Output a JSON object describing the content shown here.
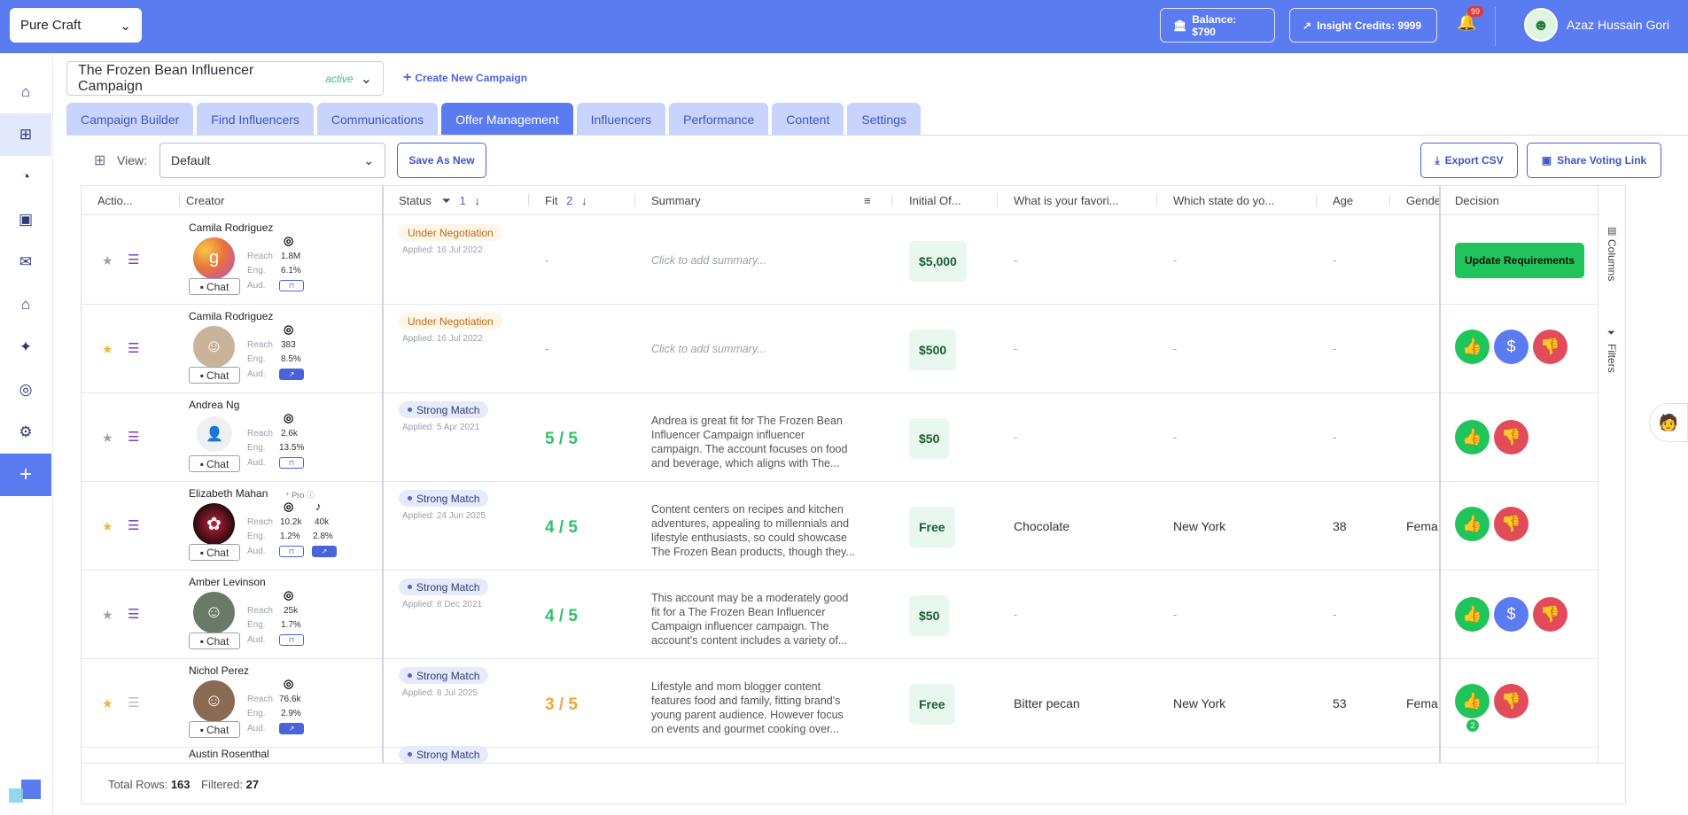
{
  "brand": {
    "name": "Pure Craft"
  },
  "top": {
    "balance": "Balance: $790",
    "credits": "Insight Credits: 9999",
    "notif_count": "99",
    "user": "Azaz Hussain Gori"
  },
  "campaign": {
    "name": "The Frozen Bean Influencer Campaign",
    "status": "active",
    "create_label": "Create New Campaign"
  },
  "tabs": [
    "Campaign Builder",
    "Find Influencers",
    "Communications",
    "Offer Management",
    "Influencers",
    "Performance",
    "Content",
    "Settings"
  ],
  "active_tab": "Offer Management",
  "view": {
    "label": "View:",
    "value": "Default",
    "save_as_new": "Save As New",
    "export": "Export CSV",
    "share": "Share Voting Link"
  },
  "columns": {
    "actions": "Actio...",
    "creator": "Creator",
    "status": "Status",
    "status_sort": "1",
    "fit": "Fit",
    "fit_sort": "2",
    "summary": "Summary",
    "initial_offer": "Initial Of...",
    "favorite": "What is your favori...",
    "state": "Which state do yo...",
    "age": "Age",
    "gender": "Gende",
    "decision": "Decision"
  },
  "side_panel": {
    "columns": "Columns",
    "filters": "Filters"
  },
  "metric_labels": {
    "reach": "Reach",
    "eng": "Eng.",
    "aud": "Aud.",
    "chat": "Chat",
    "pro": "Pro"
  },
  "rows": [
    {
      "name": "Camila Rodriguez",
      "starred": false,
      "reach": "1.8M",
      "eng": "6.1%",
      "status": "Under Negotiation",
      "applied": "Applied: 16 Jul 2022",
      "fit": "-",
      "summary": "Click to add summary...",
      "offer": "$5,000",
      "favorite": "-",
      "state": "-",
      "age": "-",
      "gender": "",
      "decision": "Update Requirements"
    },
    {
      "name": "Camila Rodriguez",
      "starred": true,
      "reach": "383",
      "eng": "8.5%",
      "status": "Under Negotiation",
      "applied": "Applied: 16 Jul 2022",
      "fit": "-",
      "summary": "Click to add summary...",
      "offer": "$500",
      "favorite": "-",
      "state": "-",
      "age": "-",
      "gender": ""
    },
    {
      "name": "Andrea Ng",
      "starred": false,
      "reach": "2.6k",
      "eng": "13.5%",
      "status": "Strong Match",
      "applied": "Applied: 5 Apr 2021",
      "fit": "5 / 5",
      "summary": "Andrea is great fit for The Frozen Bean Influencer Campaign influencer campaign. The account focuses on food and beverage, which aligns with The...",
      "offer": "$50",
      "favorite": "-",
      "state": "-",
      "age": "-",
      "gender": ""
    },
    {
      "name": "Elizabeth Mahan",
      "starred": true,
      "reach": "10.2k",
      "eng": "1.2%",
      "reach2": "40k",
      "eng2": "2.8%",
      "status": "Strong Match",
      "applied": "Applied: 24 Jun 2025",
      "fit": "4 / 5",
      "summary": "Content centers on recipes and kitchen adventures, appealing to millennials and lifestyle enthusiasts, so could showcase The Frozen Bean products, though they...",
      "offer": "Free",
      "favorite": "Chocolate",
      "state": "New York",
      "age": "38",
      "gender": "Femal"
    },
    {
      "name": "Amber Levinson",
      "starred": false,
      "reach": "25k",
      "eng": "1.7%",
      "status": "Strong Match",
      "applied": "Applied: 8 Dec 2021",
      "fit": "4 / 5",
      "summary": "This account may be a moderately good fit for a The Frozen Bean Influencer Campaign influencer campaign. The account's content includes a variety of...",
      "offer": "$50",
      "favorite": "-",
      "state": "-",
      "age": "-",
      "gender": ""
    },
    {
      "name": "Nichol Perez",
      "starred": true,
      "reach": "76.6k",
      "eng": "2.9%",
      "status": "Strong Match",
      "applied": "Applied: 8 Jul 2025",
      "fit": "3 / 5",
      "summary": "Lifestyle and mom blogger content features food and family, fitting brand's young parent audience. However focus on events and gourmet cooking over...",
      "offer": "Free",
      "favorite": "Bitter pecan",
      "state": "New York",
      "age": "53",
      "gender": "Femal",
      "approve_count": "2"
    },
    {
      "name": "Austin Rosenthal",
      "status": "Strong Match"
    }
  ],
  "footer": {
    "total_label": "Total Rows:",
    "total": "163",
    "filtered_label": "Filtered:",
    "filtered": "27"
  },
  "colors": {
    "brand": "#5b7bf0",
    "approve": "#21c45a",
    "reject": "#e14b5a",
    "fit_green": "#2ec26a",
    "fit_orange": "#f0a63a"
  }
}
